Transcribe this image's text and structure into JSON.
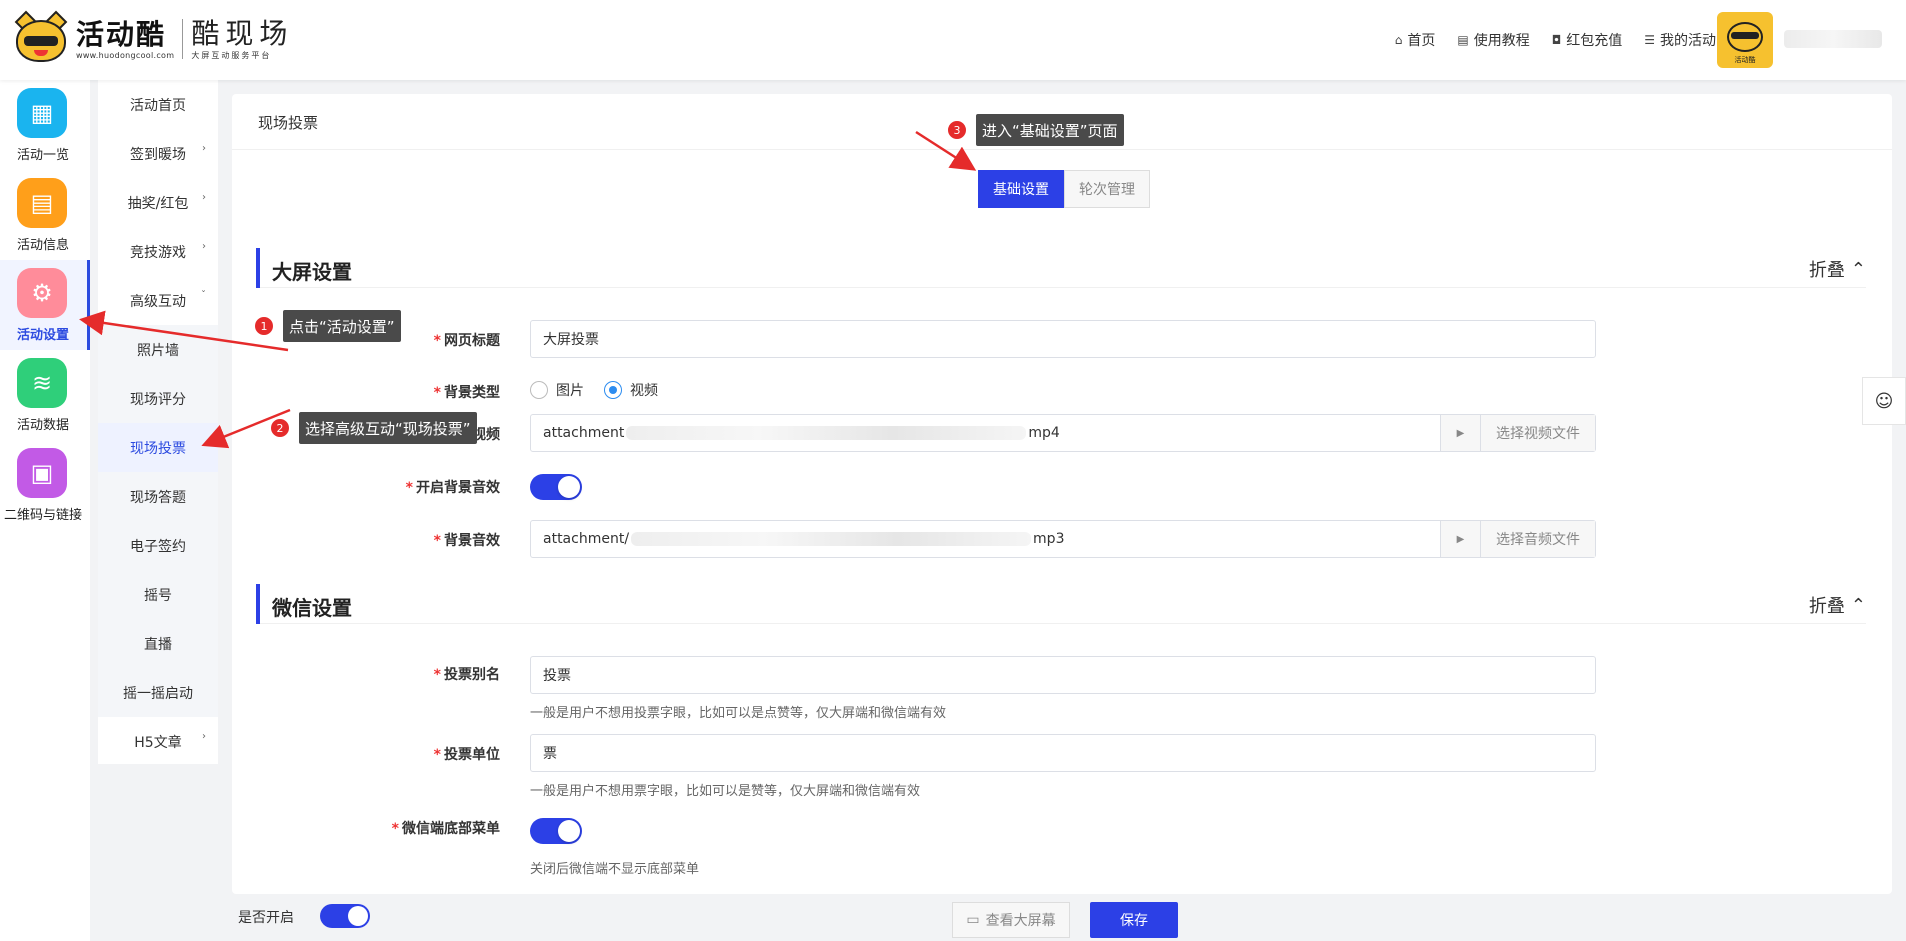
{
  "header": {
    "logo_main": "活动酷",
    "logo_url": "www.huodongcool.com",
    "brand_name": "酷现场",
    "brand_sub": "大屏互动服务平台",
    "nav": [
      {
        "label": "首页",
        "icon": "home-icon",
        "glyph": "⌂"
      },
      {
        "label": "使用教程",
        "icon": "book-icon",
        "glyph": "▤"
      },
      {
        "label": "红包充值",
        "icon": "wallet-icon",
        "glyph": "◘"
      },
      {
        "label": "我的活动",
        "icon": "list-icon",
        "glyph": "☰"
      }
    ],
    "avatar_label": "活动酷"
  },
  "iconbar": [
    {
      "label": "活动一览",
      "color": "#1ab4ef",
      "glyph": "▦",
      "icon": "grid-icon"
    },
    {
      "label": "活动信息",
      "color": "#ff9f1a",
      "glyph": "▤",
      "icon": "document-icon"
    },
    {
      "label": "活动设置",
      "color": "#ff8c9a",
      "glyph": "⚙",
      "icon": "gear-icon"
    },
    {
      "label": "活动数据",
      "color": "#2fcf7a",
      "glyph": "≋",
      "icon": "database-icon"
    },
    {
      "label": "二维码与链接",
      "color": "#c25ae6",
      "glyph": "▣",
      "icon": "qrcode-icon"
    }
  ],
  "submenu": [
    {
      "label": "活动首页",
      "arrow": ""
    },
    {
      "label": "签到暖场",
      "arrow": "›"
    },
    {
      "label": "抽奖/红包",
      "arrow": "›"
    },
    {
      "label": "竞技游戏",
      "arrow": "›"
    },
    {
      "label": "高级互动",
      "arrow": "ˇ"
    },
    {
      "label": "照片墙",
      "arrow": ""
    },
    {
      "label": "现场评分",
      "arrow": ""
    },
    {
      "label": "现场投票",
      "arrow": ""
    },
    {
      "label": "现场答题",
      "arrow": ""
    },
    {
      "label": "电子签约",
      "arrow": ""
    },
    {
      "label": "摇号",
      "arrow": ""
    },
    {
      "label": "直播",
      "arrow": ""
    },
    {
      "label": "摇一摇启动",
      "arrow": ""
    },
    {
      "label": "H5文章",
      "arrow": "›"
    }
  ],
  "main": {
    "title": "现场投票",
    "tabs": [
      "基础设置",
      "轮次管理"
    ],
    "fold_label": "折叠",
    "fold_icon": "⌃",
    "screen_section": {
      "title": "大屏设置",
      "page_title_label": "网页标题",
      "page_title_value": "大屏投票",
      "bg_type_label": "背景类型",
      "bg_type_options": [
        "图片",
        "视频"
      ],
      "bg_video_label": "背景视频",
      "bg_video_prefix": "attachment",
      "bg_video_suffix": "mp4",
      "bg_video_button": "选择视频文件",
      "bg_music_switch_label": "开启背景音效",
      "bg_music_label": "背景音效",
      "bg_music_prefix": "attachment/",
      "bg_music_suffix": "mp3",
      "bg_music_button": "选择音频文件"
    },
    "wechat_section": {
      "title": "微信设置",
      "vote_alias_label": "投票别名",
      "vote_alias_value": "投票",
      "vote_alias_help": "一般是用户不想用投票字眼，比如可以是点赞等，仅大屏端和微信端有效",
      "vote_unit_label": "投票单位",
      "vote_unit_value": "票",
      "vote_unit_help": "一般是用户不想用票字眼，比如可以是赞等，仅大屏端和微信端有效",
      "bottom_menu_label": "微信端底部菜单",
      "bottom_menu_help": "关闭后微信端不显示底部菜单"
    }
  },
  "footer": {
    "enable_label": "是否开启",
    "preview_label": "查看大屏幕",
    "save_label": "保存"
  },
  "annotations": [
    {
      "num": "1",
      "text": "点击“活动设置”"
    },
    {
      "num": "2",
      "text": "选择高级互动“现场投票”"
    },
    {
      "num": "3",
      "text": "进入“基础设置”页面"
    }
  ],
  "qq_icon": "qq-icon"
}
